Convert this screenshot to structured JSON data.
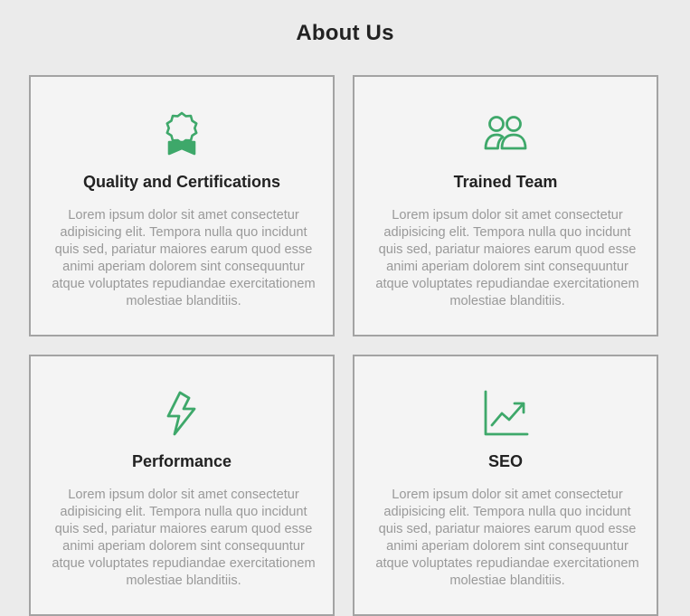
{
  "page": {
    "title": "About Us"
  },
  "colors": {
    "accent": "#3ea86a",
    "background": "#ebebeb",
    "card_background": "#f4f4f4",
    "card_border": "#a3a3a3",
    "body_text": "#999999",
    "heading_text": "#222222"
  },
  "cards": [
    {
      "icon": "award-icon",
      "title": "Quality and Certifications",
      "text": "Lorem ipsum dolor sit amet consectetur adipisicing elit. Tempora nulla quo incidunt quis sed, pariatur maiores earum quod esse animi aperiam dolorem sint consequuntur atque voluptates repudiandae exercitationem molestiae blanditiis."
    },
    {
      "icon": "users-icon",
      "title": "Trained Team",
      "text": "Lorem ipsum dolor sit amet consectetur adipisicing elit. Tempora nulla quo incidunt quis sed, pariatur maiores earum quod esse animi aperiam dolorem sint consequuntur atque voluptates repudiandae exercitationem molestiae blanditiis."
    },
    {
      "icon": "lightning-icon",
      "title": "Performance",
      "text": "Lorem ipsum dolor sit amet consectetur adipisicing elit. Tempora nulla quo incidunt quis sed, pariatur maiores earum quod esse animi aperiam dolorem sint consequuntur atque voluptates repudiandae exercitationem molestiae blanditiis."
    },
    {
      "icon": "chart-line-icon",
      "title": "SEO",
      "text": "Lorem ipsum dolor sit amet consectetur adipisicing elit. Tempora nulla quo incidunt quis sed, pariatur maiores earum quod esse animi aperiam dolorem sint consequuntur atque voluptates repudiandae exercitationem molestiae blanditiis."
    }
  ]
}
